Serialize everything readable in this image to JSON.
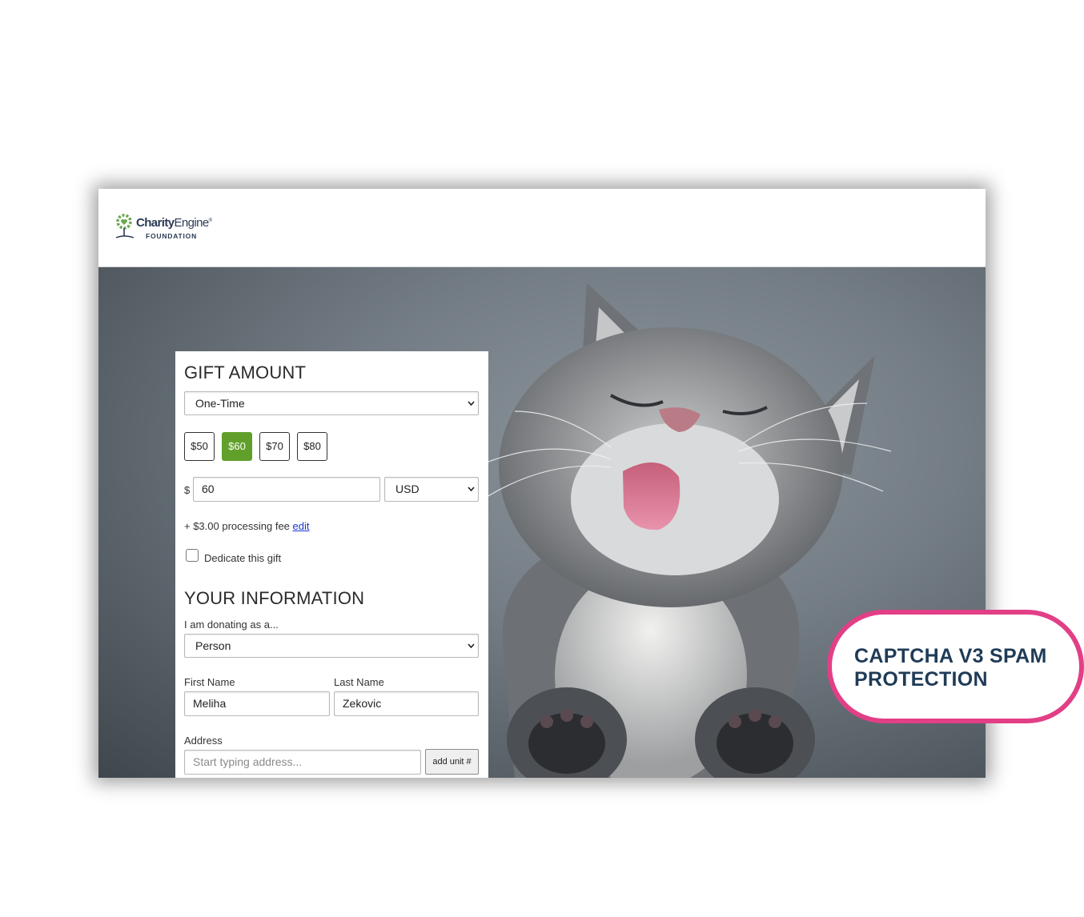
{
  "header": {
    "logo_name_bold": "Charity",
    "logo_name_rest": "Engine",
    "logo_sub": "FOUNDATION"
  },
  "gift": {
    "heading": "GIFT AMOUNT",
    "frequency": "One-Time",
    "amounts": [
      "$50",
      "$60",
      "$70",
      "$80"
    ],
    "selected_amount": "$60",
    "currency_symbol": "$",
    "amount_value": "60",
    "currency": "USD",
    "fee_text": "+ $3.00 processing fee",
    "fee_edit_link": "edit",
    "dedicate_label": "Dedicate this gift",
    "accent_color": "#60a02a"
  },
  "info": {
    "heading": "YOUR INFORMATION",
    "donating_as_label": "I am donating as a...",
    "donating_as_value": "Person",
    "first_name_label": "First Name",
    "first_name_value": "Meliha",
    "last_name_label": "Last Name",
    "last_name_value": "Zekovic",
    "address_label": "Address",
    "address_placeholder": "Start typing address...",
    "add_unit_label": "add unit #"
  },
  "callout": {
    "text": "CAPTCHA V3 SPAM PROTECTION",
    "border_color": "#e23f87",
    "text_color": "#1f3b57"
  }
}
